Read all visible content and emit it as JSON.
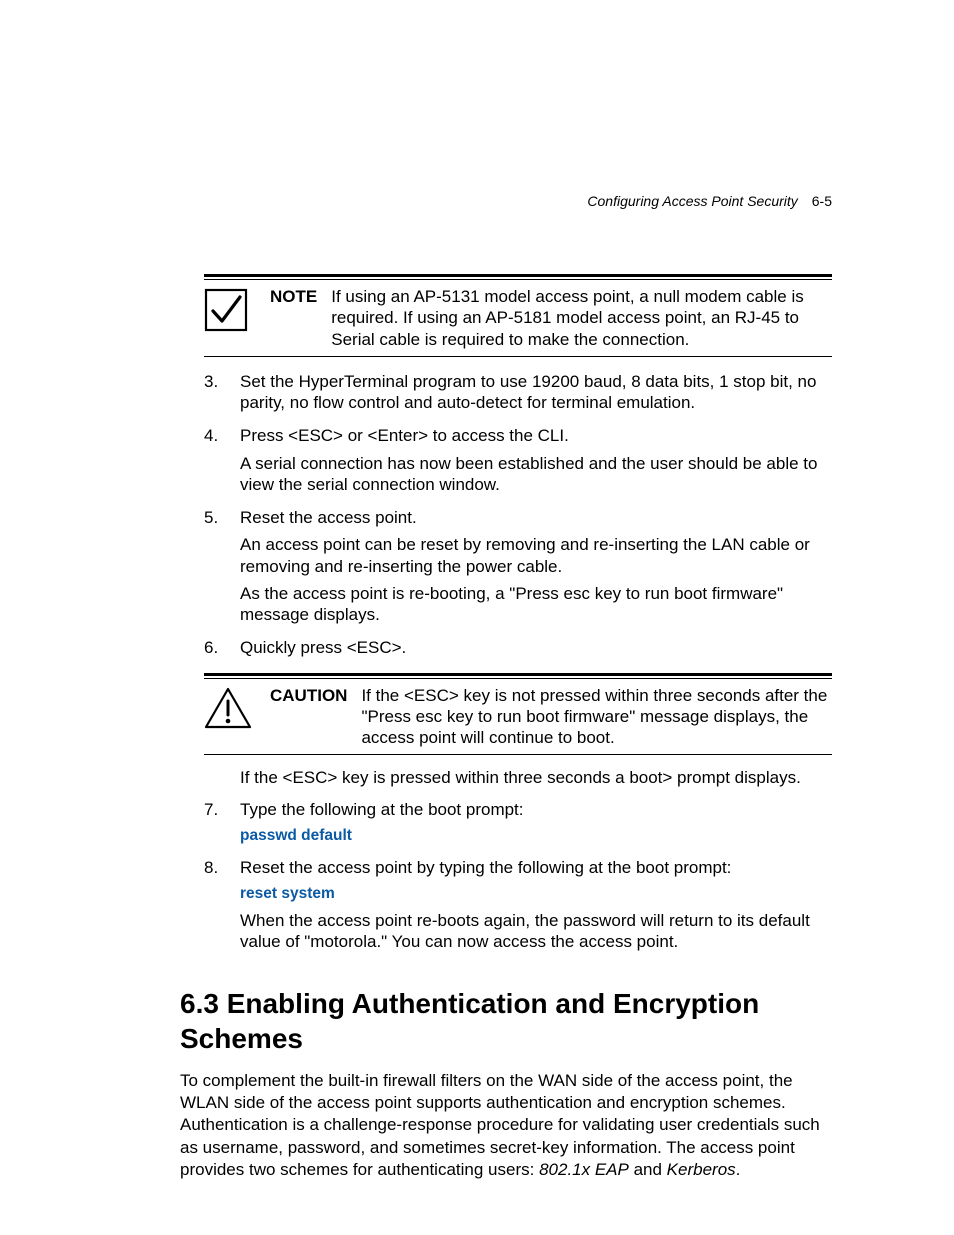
{
  "header": {
    "title": "Configuring Access Point Security",
    "page": "6-5"
  },
  "callouts": {
    "note": {
      "label": "NOTE",
      "text": "If using an AP-5131 model access point, a null modem cable is required. If using an AP-5181 model access point, an RJ-45 to Serial cable is required to make the connection."
    },
    "caution": {
      "label": "CAUTION",
      "text": "If the <ESC> key is not pressed within three seconds after the \"Press esc key to run boot firmware\" message displays, the access point will continue to boot."
    }
  },
  "steps": {
    "s3": {
      "num": "3.",
      "p1": "Set the HyperTerminal program to use 19200 baud, 8 data bits, 1 stop bit, no parity, no flow control and auto-detect for terminal emulation."
    },
    "s4": {
      "num": "4.",
      "p1": "Press <ESC> or <Enter> to access the CLI.",
      "p2": "A serial connection has now been established and the user should be able to view the serial connection window."
    },
    "s5": {
      "num": "5.",
      "p1": "Reset the access point.",
      "p2": "An access point can be reset by removing and re-inserting the LAN cable or removing and re-inserting the power cable.",
      "p3": "As the access point is re-booting, a \"Press esc key to run boot firmware\" message displays."
    },
    "s6": {
      "num": "6.",
      "p1": "Quickly press <ESC>."
    },
    "s7": {
      "num": "7.",
      "p1": "Type the following at the boot prompt:",
      "cmd": "passwd default"
    },
    "s8": {
      "num": "8.",
      "p1": "Reset the access point by typing the following at the boot prompt:",
      "cmd": "reset system",
      "p2": "When the access point re-boots again, the password will return to its default value of \"motorola.\" You can now access the access point."
    }
  },
  "after_esc": "If the <ESC> key is pressed within three seconds a boot> prompt displays.",
  "section": {
    "heading": "6.3 Enabling Authentication and Encryption Schemes",
    "para_lead": "To complement the built-in firewall filters on the WAN side of the access point, the WLAN side of the access point supports authentication and encryption schemes. Authentication is a challenge-response procedure for validating user credentials such as username, password, and sometimes secret-key information. The access point provides two schemes for authenticating users: ",
    "eap": "802.1x EAP",
    "and": " and ",
    "kerberos": "Kerberos",
    "period": "."
  }
}
